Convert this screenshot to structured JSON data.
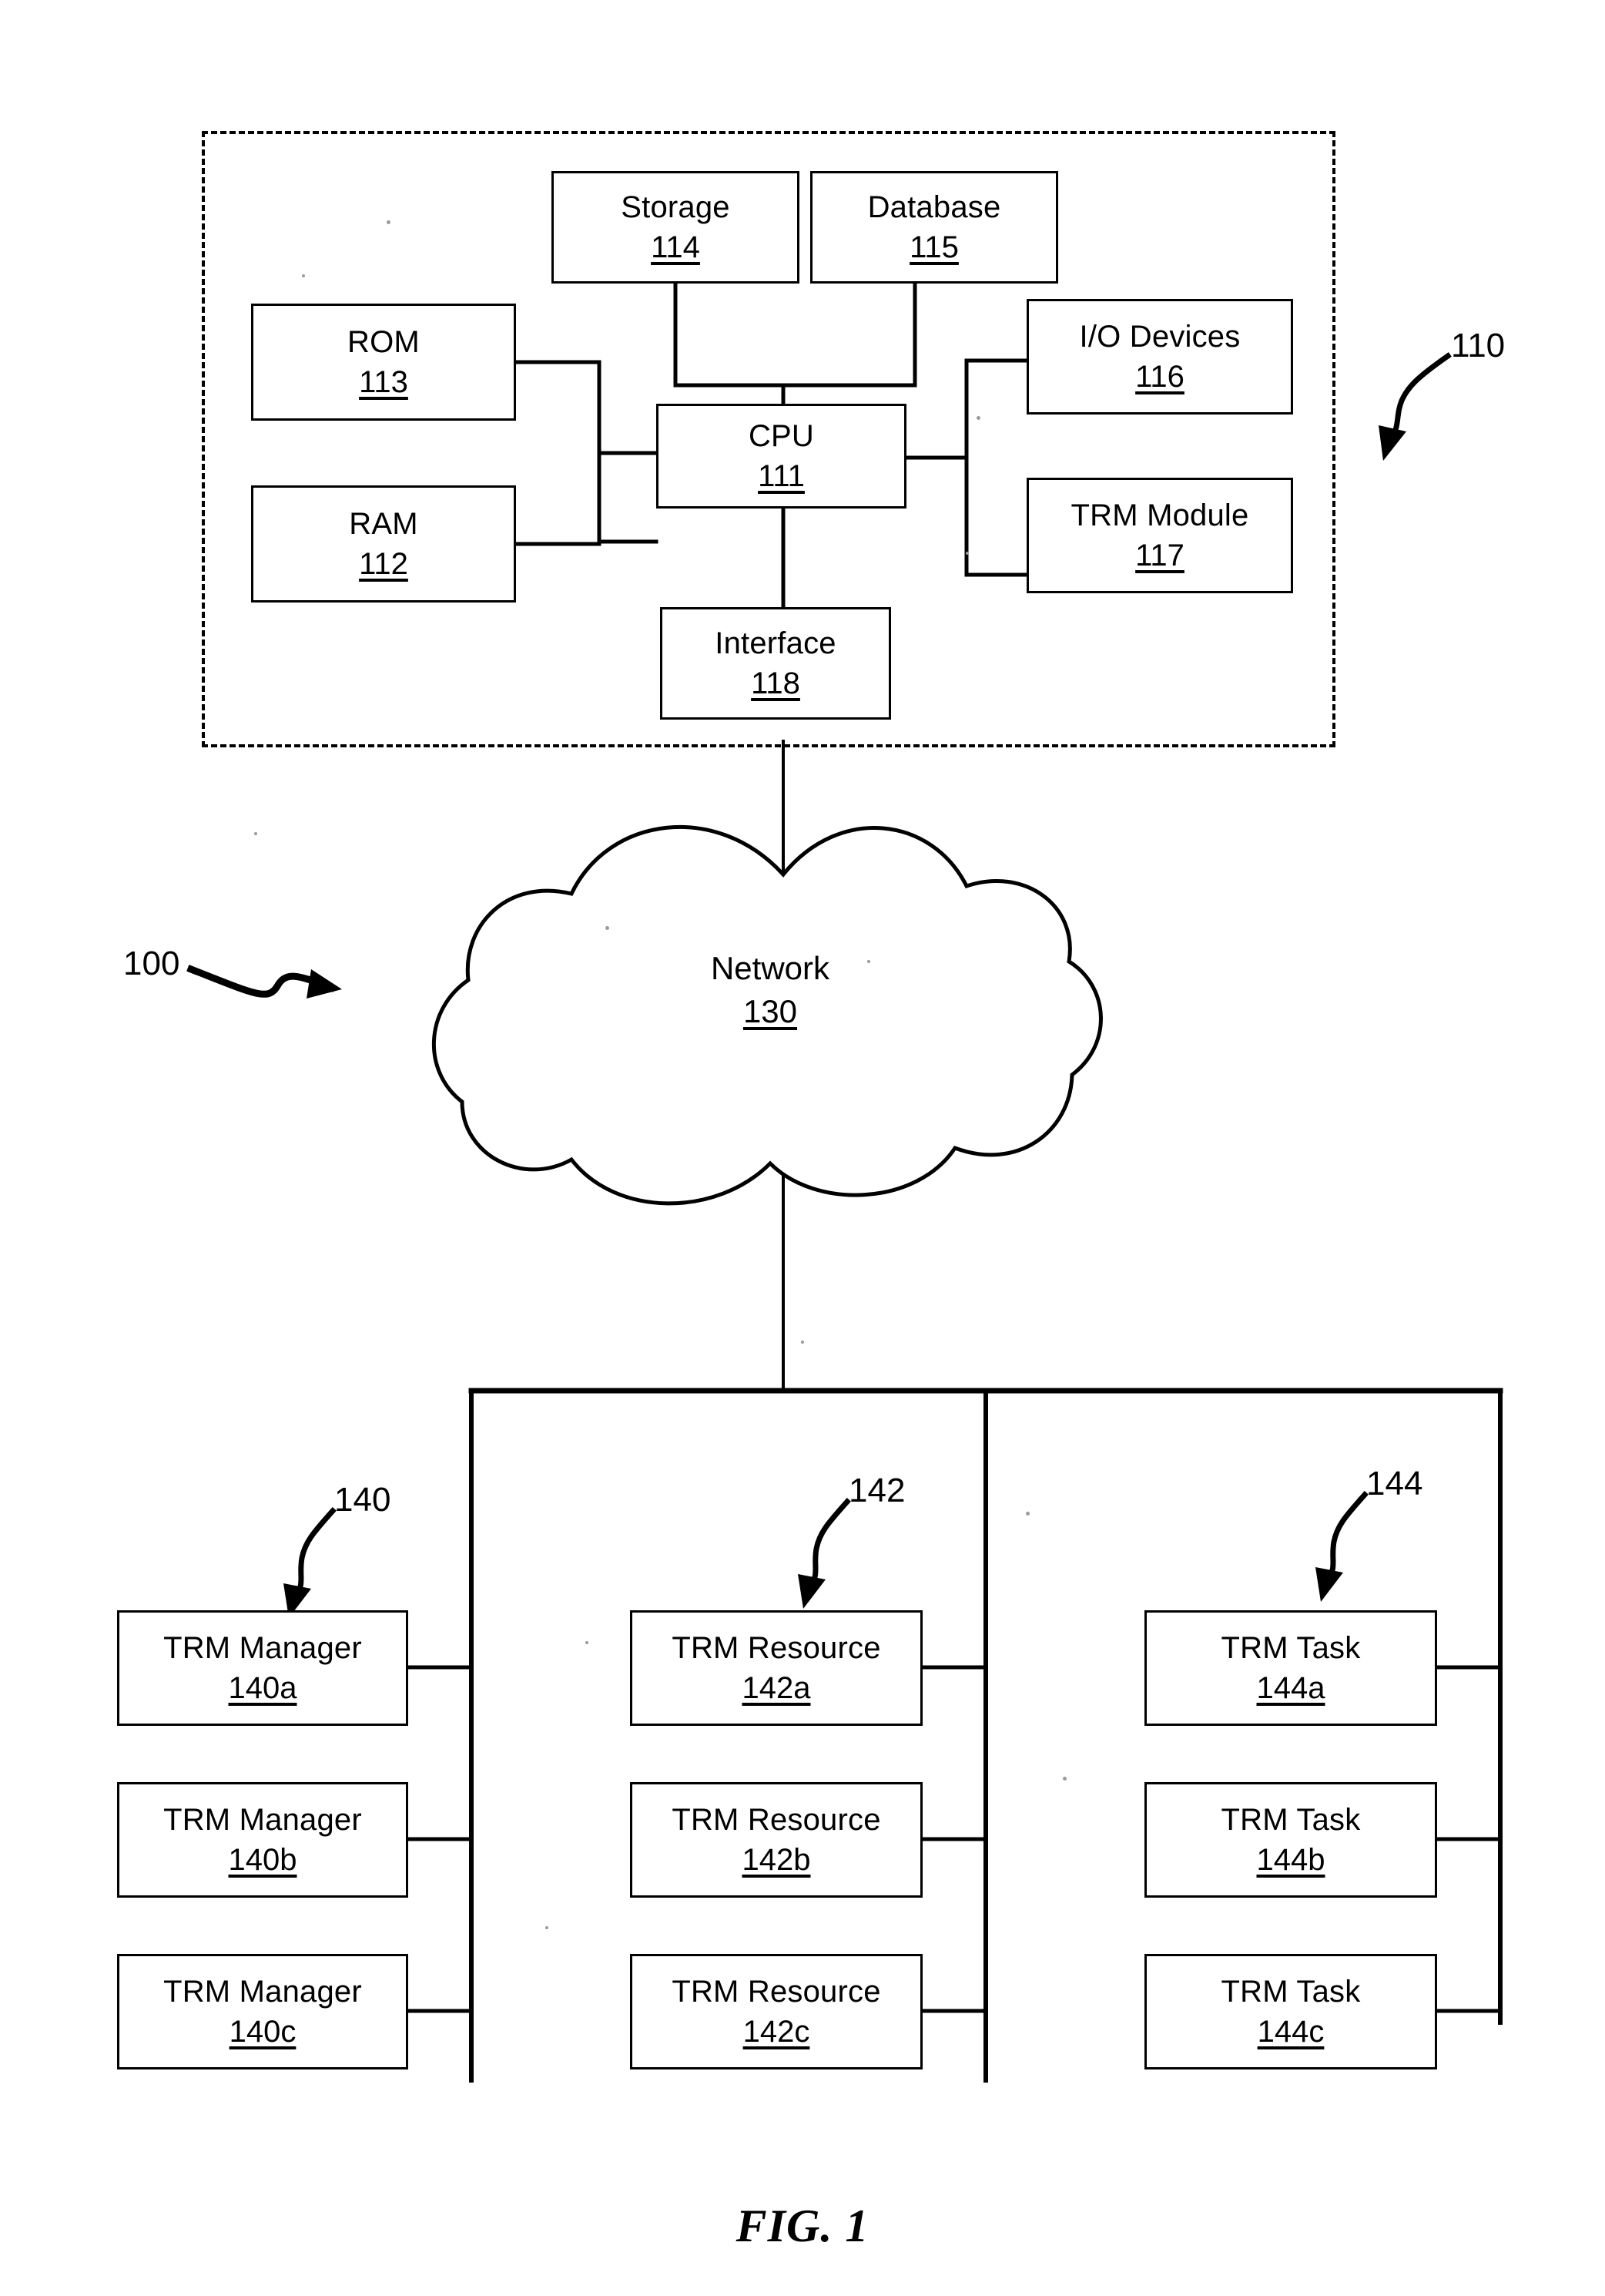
{
  "figure": {
    "caption": "FIG. 1",
    "system_ref": "100"
  },
  "enclosure": {
    "ref": "110"
  },
  "computer_nodes": [
    {
      "id": "storage",
      "label": "Storage",
      "ref": "114"
    },
    {
      "id": "database",
      "label": "Database",
      "ref": "115"
    },
    {
      "id": "rom",
      "label": "ROM",
      "ref": "113"
    },
    {
      "id": "ram",
      "label": "RAM",
      "ref": "112"
    },
    {
      "id": "cpu",
      "label": "CPU",
      "ref": "111"
    },
    {
      "id": "io-devices",
      "label": "I/O Devices",
      "ref": "116"
    },
    {
      "id": "trm-module",
      "label": "TRM Module",
      "ref": "117"
    },
    {
      "id": "interface",
      "label": "Interface",
      "ref": "118"
    }
  ],
  "network": {
    "label": "Network",
    "ref": "130"
  },
  "groups": [
    {
      "id": "managers",
      "ref": "140",
      "items": [
        {
          "label": "TRM Manager",
          "ref": "140a"
        },
        {
          "label": "TRM Manager",
          "ref": "140b"
        },
        {
          "label": "TRM Manager",
          "ref": "140c"
        }
      ]
    },
    {
      "id": "resources",
      "ref": "142",
      "items": [
        {
          "label": "TRM Resource",
          "ref": "142a"
        },
        {
          "label": "TRM Resource",
          "ref": "142b"
        },
        {
          "label": "TRM Resource",
          "ref": "142c"
        }
      ]
    },
    {
      "id": "tasks",
      "ref": "144",
      "items": [
        {
          "label": "TRM Task",
          "ref": "144a"
        },
        {
          "label": "TRM Task",
          "ref": "144b"
        },
        {
          "label": "TRM Task",
          "ref": "144c"
        }
      ]
    }
  ],
  "colors": {
    "ink": "#000000",
    "paper": "#ffffff"
  }
}
